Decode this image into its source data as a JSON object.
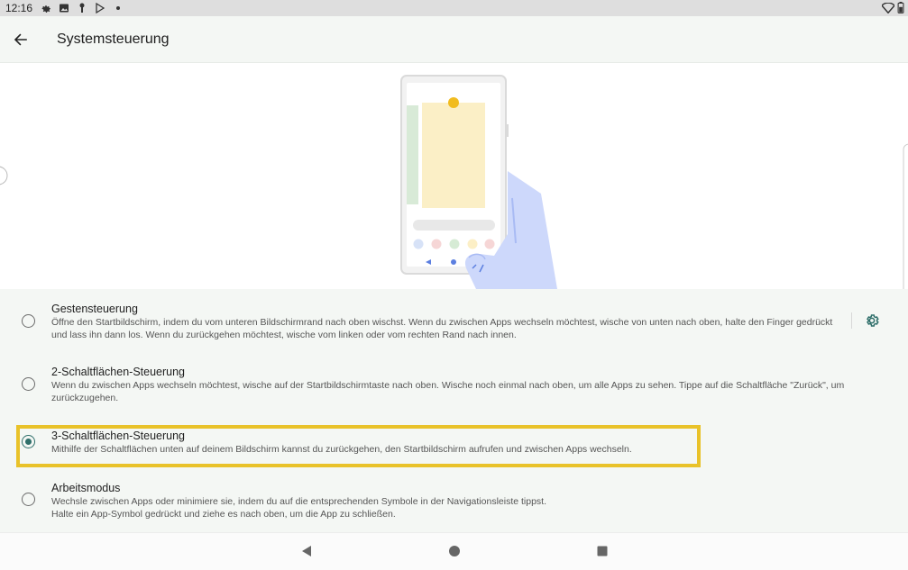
{
  "statusbar": {
    "time": "12:16",
    "icons": [
      "gear-icon",
      "image-icon",
      "pin-icon",
      "play-store-icon",
      "dot-icon"
    ],
    "right_icons": [
      "wifi-icon",
      "battery-icon"
    ]
  },
  "appbar": {
    "title": "Systemsteuerung",
    "back_icon": "arrow-left-icon"
  },
  "options": [
    {
      "title": "Gestensteuerung",
      "description": "Öffne den Startbildschirm, indem du vom unteren Bildschirmrand nach oben wischst. Wenn du zwischen Apps wechseln möchtest, wische von unten nach oben, halte den Finger gedrückt und lass ihn dann los. Wenn du zurückgehen möchtest, wische vom linken oder vom rechten Rand nach innen.",
      "selected": false,
      "has_settings": true
    },
    {
      "title": "2-Schaltflächen-Steuerung",
      "description": "Wenn du zwischen Apps wechseln möchtest, wische auf der Startbildschirmtaste nach oben. Wische noch einmal nach oben, um alle Apps zu sehen. Tippe auf die Schaltfläche \"Zurück\", um zurückzugehen.",
      "selected": false
    },
    {
      "title": "3-Schaltflächen-Steuerung",
      "description": "Mithilfe der Schaltflächen unten auf deinem Bildschirm kannst du zurückgehen, den Startbildschirm aufrufen und zwischen Apps wechseln.",
      "selected": true
    },
    {
      "title": "Arbeitsmodus",
      "description": "Wechsle zwischen Apps oder minimiere sie, indem du auf die entsprechenden Symbole in der Navigationsleiste tippst.\nHalte ein App-Symbol gedrückt und ziehe es nach oben, um die App zu schließen.",
      "selected": false
    }
  ],
  "colors": {
    "accent": "#2f6f6a",
    "highlight": "#e9c229",
    "background": "#f4f7f4"
  },
  "navbar": {
    "buttons": [
      "back-triangle-icon",
      "home-circle-icon",
      "recents-square-icon"
    ]
  }
}
